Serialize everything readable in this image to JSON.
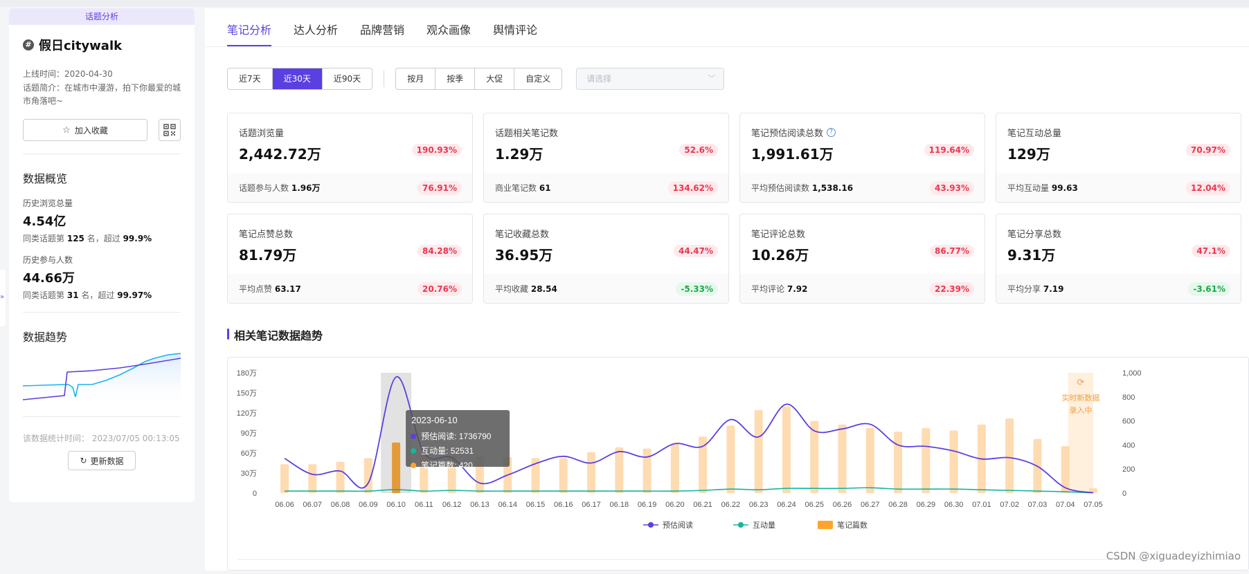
{
  "left": {
    "tag": "话题分析",
    "topic_name": "假日citywalk",
    "online_time": "上线时间：2020-04-30",
    "intro": "话题简介：在城市中漫游，拍下你最爱的城市角落吧~",
    "fav_label": "加入收藏",
    "overview_title": "数据概览",
    "browse_label": "历史浏览总量",
    "browse_value": "4.54亿",
    "browse_rank_prefix": "同类话题第",
    "browse_rank_num": "125",
    "browse_rank_mid": "名，超过",
    "browse_rank_pct": "99.9%",
    "participants_label": "历史参与人数",
    "participants_value": "44.66万",
    "participants_rank_prefix": "同类话题第",
    "participants_rank_num": "31",
    "participants_rank_mid": "名，超过",
    "participants_rank_pct": "99.97%",
    "trend_title": "数据趋势",
    "update_time": "该数据统计时间： 2023/07/05 00:13:05",
    "update_btn": "更新数据"
  },
  "tabs": [
    "笔记分析",
    "达人分析",
    "品牌营销",
    "观众画像",
    "舆情评论"
  ],
  "filters": {
    "range": [
      "近7天",
      "近30天",
      "近90天"
    ],
    "period": [
      "按月",
      "按季",
      "大促",
      "自定义"
    ],
    "select_placeholder": "请选择"
  },
  "cards": [
    {
      "label": "话题浏览量",
      "value": "2,442.72万",
      "badge": "190.93%",
      "dir": "up",
      "sub_label": "话题参与人数",
      "sub_value": "1.96万",
      "sub_badge": "76.91%",
      "sub_dir": "up"
    },
    {
      "label": "话题相关笔记数",
      "value": "1.29万",
      "badge": "52.6%",
      "dir": "up",
      "sub_label": "商业笔记数",
      "sub_value": "61",
      "sub_badge": "134.62%",
      "sub_dir": "up"
    },
    {
      "label": "笔记预估阅读总数",
      "value": "1,991.61万",
      "badge": "119.64%",
      "dir": "up",
      "sub_label": "平均预估阅读数",
      "sub_value": "1,538.16",
      "sub_badge": "43.93%",
      "sub_dir": "up",
      "help": true
    },
    {
      "label": "笔记互动总量",
      "value": "129万",
      "badge": "70.97%",
      "dir": "up",
      "sub_label": "平均互动量",
      "sub_value": "99.63",
      "sub_badge": "12.04%",
      "sub_dir": "up"
    },
    {
      "label": "笔记点赞总数",
      "value": "81.79万",
      "badge": "84.28%",
      "dir": "up",
      "sub_label": "平均点赞",
      "sub_value": "63.17",
      "sub_badge": "20.76%",
      "sub_dir": "up"
    },
    {
      "label": "笔记收藏总数",
      "value": "36.95万",
      "badge": "44.47%",
      "dir": "up",
      "sub_label": "平均收藏",
      "sub_value": "28.54",
      "sub_badge": "-5.33%",
      "sub_dir": "down"
    },
    {
      "label": "笔记评论总数",
      "value": "10.26万",
      "badge": "86.77%",
      "dir": "up",
      "sub_label": "平均评论",
      "sub_value": "7.92",
      "sub_badge": "22.39%",
      "sub_dir": "up"
    },
    {
      "label": "笔记分享总数",
      "value": "9.31万",
      "badge": "47.1%",
      "dir": "up",
      "sub_label": "平均分享",
      "sub_value": "7.19",
      "sub_badge": "-3.61%",
      "sub_dir": "down"
    }
  ],
  "trend_title": "相关笔记数据趋势",
  "realtime_label": [
    "实时新数据",
    "录入中"
  ],
  "tooltip": {
    "date": "2023-06-10",
    "rows": [
      "预估阅读: 1736790",
      "互动量: 52531",
      "笔记篇数: 420"
    ]
  },
  "watermark": "CSDN @xiguadeyizhimiao",
  "colors": {
    "accent": "#5b3fe0",
    "line_read": "#5b3fe0",
    "line_interact": "#13b59a",
    "bar": "#ffa42b",
    "up": "#e8384f",
    "down": "#1fa84a"
  },
  "chart_data": {
    "type": "bar+line",
    "categories": [
      "06.06",
      "06.07",
      "06.08",
      "06.09",
      "06.10",
      "06.11",
      "06.12",
      "06.13",
      "06.14",
      "06.15",
      "06.16",
      "06.17",
      "06.18",
      "06.19",
      "06.20",
      "06.21",
      "06.22",
      "06.23",
      "06.24",
      "06.25",
      "06.26",
      "06.27",
      "06.28",
      "06.29",
      "06.30",
      "07.01",
      "07.02",
      "07.03",
      "07.04",
      "07.05"
    ],
    "y_left_ticks": [
      "0",
      "30万",
      "60万",
      "90万",
      "120万",
      "150万",
      "180万"
    ],
    "y_left_max": 1800000,
    "y_right_ticks": [
      "0",
      "200",
      "400",
      "600",
      "800",
      "1,000"
    ],
    "y_right_max": 1000,
    "series": [
      {
        "name": "预估阅读",
        "kind": "line",
        "axis": "left",
        "values": [
          520000,
          280000,
          330000,
          150000,
          1736790,
          600000,
          530000,
          150000,
          270000,
          440000,
          550000,
          450000,
          620000,
          540000,
          740000,
          700000,
          1100000,
          840000,
          1330000,
          930000,
          960000,
          1030000,
          720000,
          700000,
          630000,
          510000,
          530000,
          400000,
          80000,
          5000
        ]
      },
      {
        "name": "互动量",
        "kind": "line",
        "axis": "left",
        "values": [
          30000,
          30000,
          30000,
          30000,
          52531,
          30000,
          40000,
          30000,
          30000,
          30000,
          30000,
          30000,
          30000,
          30000,
          30000,
          40000,
          60000,
          50000,
          70000,
          70000,
          70000,
          80000,
          60000,
          60000,
          60000,
          50000,
          40000,
          30000,
          20000,
          3000
        ]
      },
      {
        "name": "笔记篇数",
        "kind": "bar",
        "axis": "right",
        "values": [
          240,
          240,
          260,
          290,
          420,
          330,
          310,
          300,
          300,
          290,
          290,
          340,
          380,
          370,
          410,
          470,
          560,
          690,
          720,
          600,
          570,
          540,
          510,
          540,
          520,
          570,
          620,
          450,
          390,
          40
        ]
      }
    ]
  }
}
